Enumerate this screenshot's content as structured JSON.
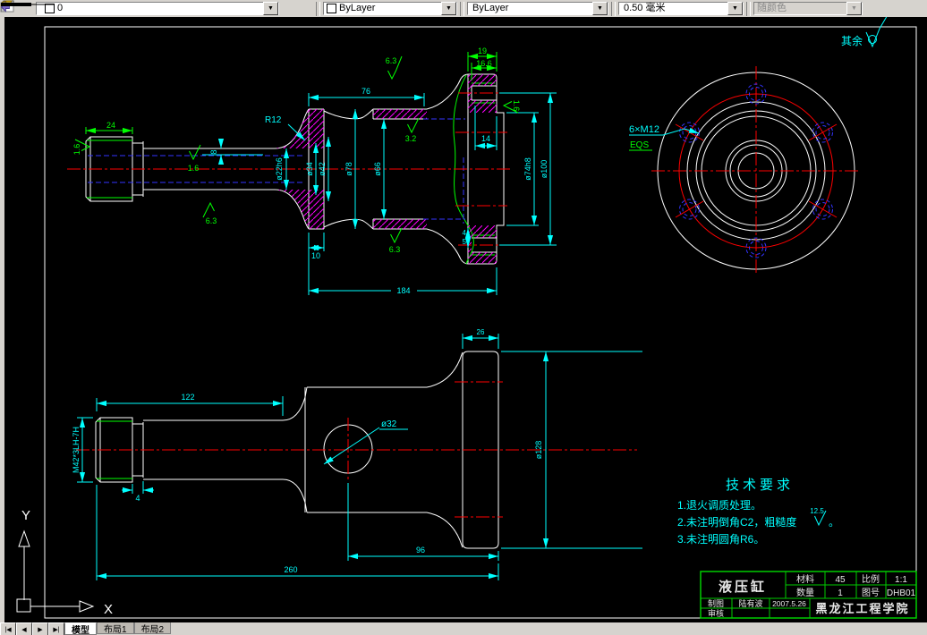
{
  "toolbar": {
    "layer": {
      "value": "0"
    },
    "color": {
      "value": "ByLayer"
    },
    "linetype": {
      "value": "ByLayer"
    },
    "lineweight": {
      "value": "0.50 毫米"
    },
    "plot_style": {
      "value": "随颜色"
    },
    "arrow": "▼"
  },
  "note": {
    "rest": "其余"
  },
  "section": {
    "dims": {
      "d24": "24",
      "d8": "8",
      "d76": "76",
      "d10": "10",
      "d184": "184",
      "d14": "14",
      "d19": "19",
      "d166": "16.6",
      "d4": "4",
      "d5": "5",
      "r12": "R12",
      "dia22": "ø22h6",
      "dia34": "ø34",
      "dia42": "ø42",
      "dia78": "ø78",
      "dia66": "ø66",
      "dia74": "ø74h8",
      "dia100": "ø100"
    },
    "rough": {
      "left": "1.6",
      "shaft": "1.6",
      "shaft_b": "6.3",
      "top": "6.3",
      "bore": "3.2",
      "bottom": "6.3",
      "face": "1.6"
    }
  },
  "end": {
    "bolt": "6×M12",
    "eqs": "EQS"
  },
  "side": {
    "dims": {
      "d122": "122",
      "d26": "26",
      "d4": "4",
      "d96": "96",
      "d260": "260",
      "thread": "M42*3LH-7H",
      "dia32": "ø32",
      "dia128": "ø128"
    }
  },
  "tech": {
    "title": "技术要求",
    "i1": "1.退火调质处理。",
    "i2a": "2.未注明倒角C2，粗糙度",
    "i2r": "12.5",
    "i2b": "。",
    "i3": "3.未注明圆角R6。"
  },
  "tb": {
    "part_name": "液压缸",
    "material_label": "材料",
    "material": "45",
    "scale_label": "比例",
    "scale": "1:1",
    "qty_label": "数量",
    "qty": "1",
    "dwg_label": "图号",
    "dwg_no": "DHB01",
    "drawn_label": "制图",
    "drawn_by": "陆有波",
    "date": "2007.5.26",
    "check_label": "审核",
    "school": "黑龙江工程学院"
  },
  "tabs": {
    "nav_first": "|◀",
    "nav_prev": "◀",
    "nav_next": "▶",
    "nav_last": "▶|",
    "model": "模型",
    "layout1": "布局1",
    "layout2": "布局2"
  },
  "ucs": {
    "x": "X",
    "y": "Y"
  }
}
